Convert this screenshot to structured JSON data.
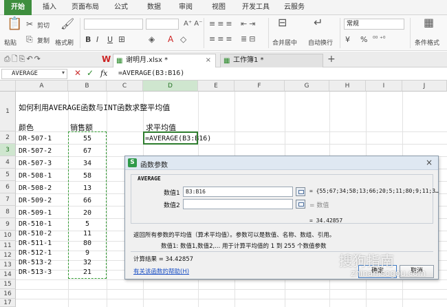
{
  "menu": [
    "开始",
    "插入",
    "页面布局",
    "公式",
    "数据",
    "审阅",
    "视图",
    "开发工具",
    "云服务"
  ],
  "ribbon": {
    "paste": "粘贴",
    "cut": "剪切",
    "copy": "复制",
    "format_painter": "格式刷",
    "bold": "B",
    "italic": "I",
    "underline": "U",
    "merge": "合并居中",
    "wrap": "自动换行",
    "number_format": "常规",
    "currency": "¥",
    "percent": "%",
    "cond_format": "条件格式"
  },
  "doc_tabs": [
    {
      "label": "谢明月.xlsx *"
    },
    {
      "label": "工作簿1 *"
    }
  ],
  "formula_bar": {
    "name_box": "AVERAGE",
    "fx": "fx",
    "formula": "=AVERAGE(B3:B16)"
  },
  "columns": [
    "A",
    "B",
    "C",
    "D",
    "E",
    "F",
    "G",
    "H",
    "I",
    "J"
  ],
  "rows": [
    "1",
    "2",
    "3",
    "4",
    "5",
    "6",
    "7",
    "8",
    "9",
    "10",
    "11",
    "12",
    "13",
    "14",
    "15",
    "16",
    "17"
  ],
  "sheet": {
    "title": "如何利用AVERAGE函数与INT函数求整平均值",
    "header_color": "颜色",
    "header_sales": "销售额",
    "header_avg": "求平均值",
    "d3_formula": "=AVERAGE(B3:B16)",
    "data": [
      {
        "code": "DR-507-1",
        "value": "55"
      },
      {
        "code": "DR-507-2",
        "value": "67"
      },
      {
        "code": "DR-507-3",
        "value": "34"
      },
      {
        "code": "DR-508-1",
        "value": "58"
      },
      {
        "code": "DR-508-2",
        "value": "13"
      },
      {
        "code": "DR-509-2",
        "value": "66"
      },
      {
        "code": "DR-509-1",
        "value": "20"
      },
      {
        "code": "DR-510-1",
        "value": "5"
      },
      {
        "code": "DR-510-2",
        "value": "11"
      },
      {
        "code": "DR-511-1",
        "value": "80"
      },
      {
        "code": "DR-512-1",
        "value": "9"
      },
      {
        "code": "DR-513-2",
        "value": "32"
      },
      {
        "code": "DR-513-3",
        "value": "21"
      }
    ]
  },
  "dialog": {
    "title": "函数参数",
    "func_name": "AVERAGE",
    "arg1_label": "数值1",
    "arg1_value": "B3:B16",
    "arg1_result": "= {55;67;34;58;13;66;20;5;11;80;9;11;3…",
    "arg2_label": "数值2",
    "arg2_result": "= 数值",
    "result_line": "= 34.42857",
    "description": "返回所有参数的平均值（算术平均值）。参数可以是数值、名称、数组、引用。",
    "arg_desc": "数值1:   数值1,数值2,... 用于计算平均值的 1 到 255 个数值参数",
    "calc_result": "计算结果 = 34.42857",
    "help_link": "有关该函数的帮助(H)",
    "ok": "确定",
    "cancel": "取消"
  },
  "watermark": {
    "main": "搜狗指南",
    "url": "zhinan.sogou.com"
  }
}
